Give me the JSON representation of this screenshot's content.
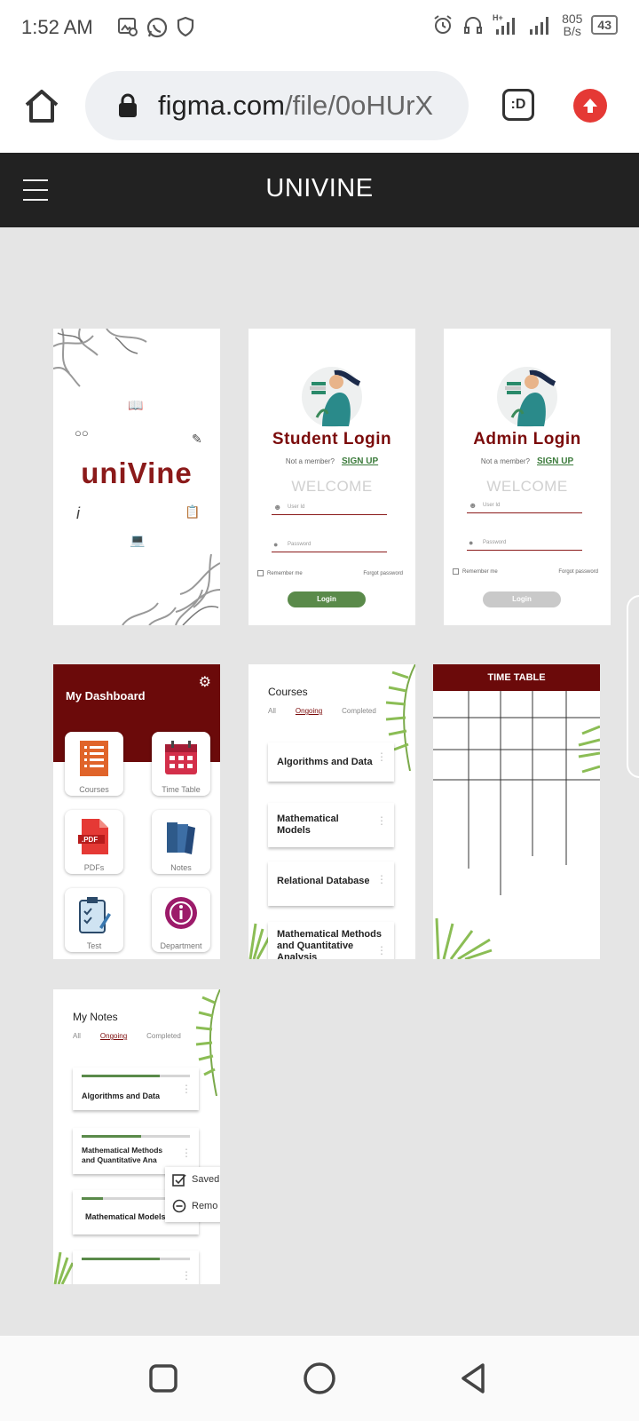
{
  "status": {
    "time": "1:52 AM",
    "net_speed_value": "805",
    "net_speed_unit": "B/s",
    "battery": "43",
    "signal": "H+"
  },
  "browser": {
    "url_prefix": "figma.com",
    "url_rest": "/file/0oHUrX",
    "tab_button": ":D"
  },
  "figma": {
    "title": "UNIVINE"
  },
  "splash": {
    "logo": "uniVine"
  },
  "student_login": {
    "title": "Student Login",
    "not_member": "Not a member?",
    "signup": "SIGN UP",
    "welcome": "WELCOME",
    "user_id": "User Id",
    "password": "Password",
    "remember": "Remember me",
    "forgot": "Forgot password",
    "login": "Login"
  },
  "admin_login": {
    "title": "Admin Login",
    "not_member": "Not a member?",
    "signup": "SIGN UP",
    "welcome": "WELCOME",
    "user_id": "User Id",
    "password": "Password",
    "remember": "Remember me",
    "forgot": "Forgot password",
    "login": "Login"
  },
  "dashboard": {
    "title": "My Dashboard",
    "tiles": [
      "Courses",
      "Time Table",
      "PDFs",
      "Notes",
      "Test",
      "Department"
    ]
  },
  "courses": {
    "title": "Courses",
    "tabs": [
      "All",
      "Ongoing",
      "Completed"
    ],
    "items": [
      "Algorithms and Data",
      "Mathematical Models",
      "Relational Database",
      "Mathematical Methods and Quantitative Analysis"
    ]
  },
  "timetable": {
    "title": "TIME TABLE"
  },
  "notes": {
    "title": "My Notes",
    "tabs": [
      "All",
      "Ongoing",
      "Completed"
    ],
    "items": [
      {
        "label": "Algorithms and Data",
        "progress": 0.72
      },
      {
        "label": "Mathematical Methods and Quantitative Ana",
        "progress": 0.55
      },
      {
        "label": "Mathematical Models",
        "progress": 0.2
      },
      {
        "label": "",
        "progress": 0.72
      }
    ],
    "menu": {
      "saved": "Saved",
      "remove": "Remo"
    }
  },
  "colors": {
    "maroon": "#6b0a0a",
    "green": "#5a8a4a",
    "header": "#222222",
    "canvas": "#e5e5e5"
  }
}
